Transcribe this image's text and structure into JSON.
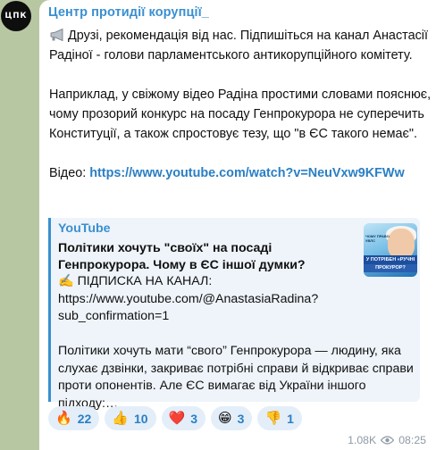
{
  "channel": {
    "avatar_text": "ЦПК",
    "name": "Центр протидії корупції_"
  },
  "post": {
    "line1": "Друзі, рекомендація від нас. Підпишіться на канал Анастасії Радіної - голови парламентського антикорупційного комітету.",
    "line2": "Наприклад, у свіжому відео Радіна простими словами пояснює, чому прозорий конкурс на посаду Генпрокурора не суперечить Конституції, а також спростовує тезу, що \"в ЄС такого немає\".",
    "video_label": "Відео: ",
    "video_url": "https://www.youtube.com/watch?v=NeuVxw9KFWw"
  },
  "preview": {
    "site": "YouTube",
    "title": "Політики хочуть \"своїх\" на посаді Генпрокурора. Чому в ЄС іншої думки?",
    "description": "✍️ ПІДПИСКА НА КАНАЛ:\nhttps://www.youtube.com/@AnastasiaRadina?sub_confirmation=1\n\nПолітики хочуть мати “свого” Генпрокурора — людину, яка слухає дзвінки, закриває потрібні справи й відкриває справи проти опонентів. Але ЄС вимагає від України іншого підходу:…",
    "thumb_top_text": "ЧОМУ ПРАВО УВЛС",
    "thumb_band1": "У ПОТРІБЕН «РУЧНІ",
    "thumb_band2": "ПРОКУРОР?"
  },
  "reactions": [
    {
      "emoji": "🔥",
      "count": "22"
    },
    {
      "emoji": "👍",
      "count": "10"
    },
    {
      "emoji": "❤️",
      "count": "3"
    },
    {
      "emoji": "😁",
      "count": "3"
    },
    {
      "emoji": "👎",
      "count": "1"
    }
  ],
  "meta": {
    "views": "1.08K",
    "time": "08:25"
  },
  "colors": {
    "accent": "#3a8fd0",
    "link": "#2a7fc4",
    "background": "#b7c7a2"
  }
}
